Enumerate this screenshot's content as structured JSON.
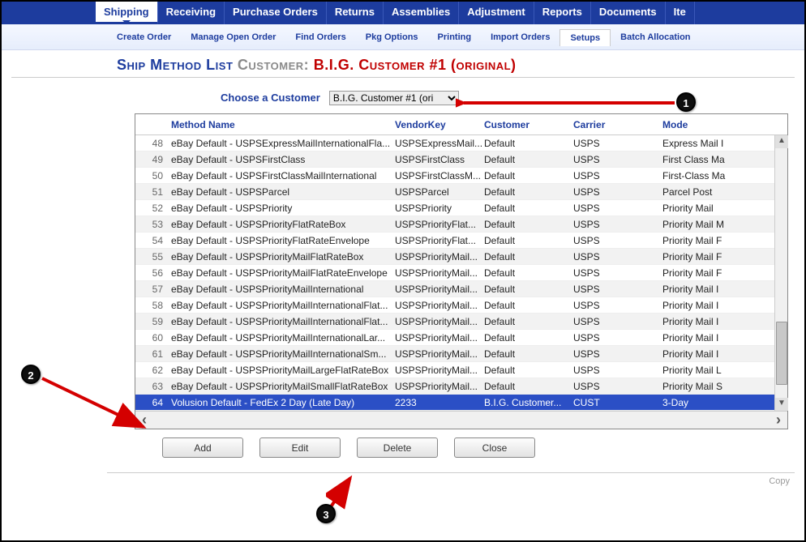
{
  "nav": {
    "main": [
      "Shipping",
      "Receiving",
      "Purchase Orders",
      "Returns",
      "Assemblies",
      "Adjustment",
      "Reports",
      "Documents",
      "Ite"
    ],
    "activeMain": 0,
    "sub": [
      "Create Order",
      "Manage Open Order",
      "Find Orders",
      "Pkg Options",
      "Printing",
      "Import Orders",
      "Setups",
      "Batch Allocation"
    ],
    "activeSub": 6
  },
  "title": {
    "main": "Ship Method List",
    "custLabel": "Customer:",
    "custName": "B.I.G. Customer #1 (original)"
  },
  "choose": {
    "label": "Choose a Customer",
    "selected": "B.I.G. Customer #1 (ori"
  },
  "grid": {
    "headers": {
      "method": "Method Name",
      "vendor": "VendorKey",
      "customer": "Customer",
      "carrier": "Carrier",
      "mode": "Mode"
    },
    "rows": [
      {
        "n": 48,
        "method": "eBay Default - USPSExpressMailInternationalFla...",
        "vendor": "USPSExpressMail...",
        "customer": "Default",
        "carrier": "USPS",
        "mode": "Express Mail I"
      },
      {
        "n": 49,
        "method": "eBay Default - USPSFirstClass",
        "vendor": "USPSFirstClass",
        "customer": "Default",
        "carrier": "USPS",
        "mode": "First Class Ma"
      },
      {
        "n": 50,
        "method": "eBay Default - USPSFirstClassMailInternational",
        "vendor": "USPSFirstClassM...",
        "customer": "Default",
        "carrier": "USPS",
        "mode": "First-Class Ma"
      },
      {
        "n": 51,
        "method": "eBay Default - USPSParcel",
        "vendor": "USPSParcel",
        "customer": "Default",
        "carrier": "USPS",
        "mode": "Parcel Post"
      },
      {
        "n": 52,
        "method": "eBay Default - USPSPriority",
        "vendor": "USPSPriority",
        "customer": "Default",
        "carrier": "USPS",
        "mode": "Priority Mail"
      },
      {
        "n": 53,
        "method": "eBay Default - USPSPriorityFlatRateBox",
        "vendor": "USPSPriorityFlat...",
        "customer": "Default",
        "carrier": "USPS",
        "mode": "Priority Mail M"
      },
      {
        "n": 54,
        "method": "eBay Default - USPSPriorityFlatRateEnvelope",
        "vendor": "USPSPriorityFlat...",
        "customer": "Default",
        "carrier": "USPS",
        "mode": "Priority Mail F"
      },
      {
        "n": 55,
        "method": "eBay Default - USPSPriorityMailFlatRateBox",
        "vendor": "USPSPriorityMail...",
        "customer": "Default",
        "carrier": "USPS",
        "mode": "Priority Mail F"
      },
      {
        "n": 56,
        "method": "eBay Default - USPSPriorityMailFlatRateEnvelope",
        "vendor": "USPSPriorityMail...",
        "customer": "Default",
        "carrier": "USPS",
        "mode": "Priority Mail F"
      },
      {
        "n": 57,
        "method": "eBay Default - USPSPriorityMailInternational",
        "vendor": "USPSPriorityMail...",
        "customer": "Default",
        "carrier": "USPS",
        "mode": "Priority Mail I"
      },
      {
        "n": 58,
        "method": "eBay Default - USPSPriorityMailInternationalFlat...",
        "vendor": "USPSPriorityMail...",
        "customer": "Default",
        "carrier": "USPS",
        "mode": "Priority Mail I"
      },
      {
        "n": 59,
        "method": "eBay Default - USPSPriorityMailInternationalFlat...",
        "vendor": "USPSPriorityMail...",
        "customer": "Default",
        "carrier": "USPS",
        "mode": "Priority Mail I"
      },
      {
        "n": 60,
        "method": "eBay Default - USPSPriorityMailInternationalLar...",
        "vendor": "USPSPriorityMail...",
        "customer": "Default",
        "carrier": "USPS",
        "mode": "Priority Mail I"
      },
      {
        "n": 61,
        "method": "eBay Default - USPSPriorityMailInternationalSm...",
        "vendor": "USPSPriorityMail...",
        "customer": "Default",
        "carrier": "USPS",
        "mode": "Priority Mail I"
      },
      {
        "n": 62,
        "method": "eBay Default - USPSPriorityMailLargeFlatRateBox",
        "vendor": "USPSPriorityMail...",
        "customer": "Default",
        "carrier": "USPS",
        "mode": "Priority Mail L"
      },
      {
        "n": 63,
        "method": "eBay Default - USPSPriorityMailSmallFlatRateBox",
        "vendor": "USPSPriorityMail...",
        "customer": "Default",
        "carrier": "USPS",
        "mode": "Priority Mail S"
      },
      {
        "n": 64,
        "method": "Volusion Default - FedEx 2 Day (Late Day)",
        "vendor": "2233",
        "customer": "B.I.G. Customer...",
        "carrier": "CUST",
        "mode": "3-Day",
        "selected": true
      }
    ]
  },
  "buttons": {
    "add": "Add",
    "edit": "Edit",
    "delete": "Delete",
    "close": "Close"
  },
  "footer": "Copy",
  "callouts": {
    "c1": "1",
    "c2": "2",
    "c3": "3"
  }
}
